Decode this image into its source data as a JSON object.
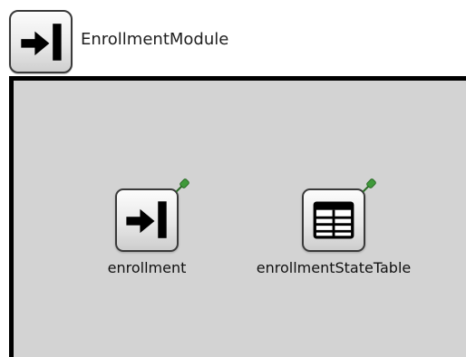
{
  "module": {
    "title": "EnrollmentModule",
    "icon": "module-input-icon"
  },
  "canvas": {
    "items": [
      {
        "label": "enrollment",
        "icon": "input-arrow-icon",
        "badge": "pin-icon"
      },
      {
        "label": "enrollmentStateTable",
        "icon": "table-grid-icon",
        "badge": "pin-icon"
      }
    ]
  },
  "colors": {
    "canvas_background": "#d3d3d3",
    "canvas_border": "#000000",
    "pin_green": "#3f9a3a"
  }
}
